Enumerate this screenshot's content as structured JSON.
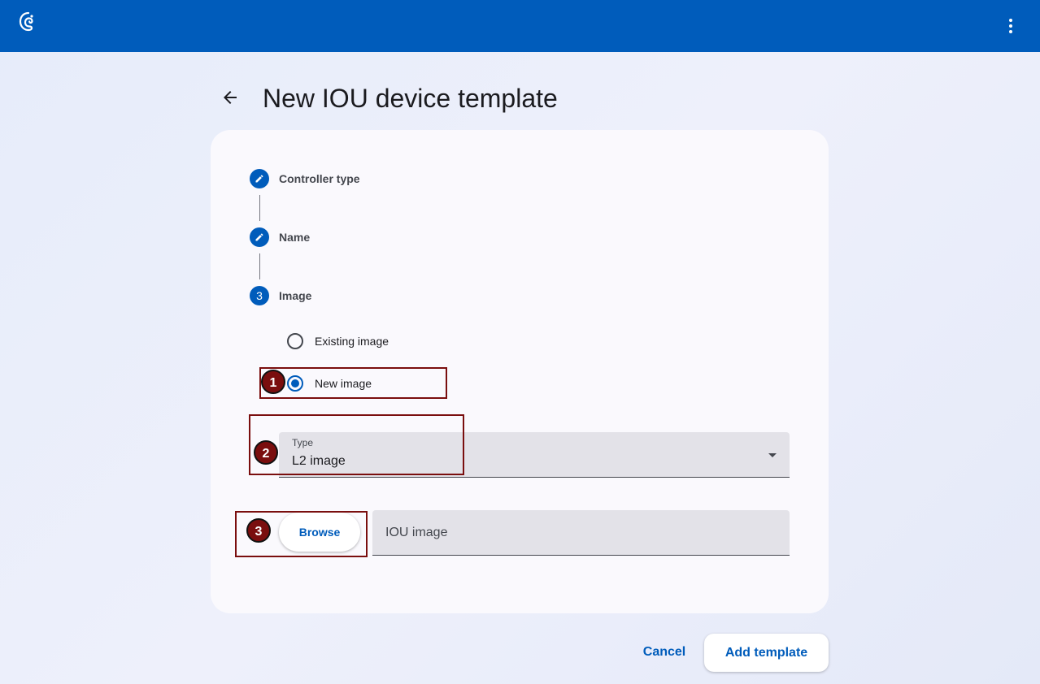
{
  "app": {
    "logo_icon": "chameleon-logo-icon",
    "menu_icon": "more-vert-icon",
    "brand_color": "#005cbb"
  },
  "page": {
    "title": "New IOU device template",
    "back_icon": "arrow-back-icon"
  },
  "stepper": {
    "steps": [
      {
        "marker": "edit-icon",
        "label": "Controller type"
      },
      {
        "marker": "edit-icon",
        "label": "Name"
      },
      {
        "number": "3",
        "label": "Image"
      }
    ]
  },
  "image_step": {
    "options": [
      {
        "label": "Existing image",
        "selected": false
      },
      {
        "label": "New image",
        "selected": true
      }
    ],
    "type_field": {
      "label": "Type",
      "value": "L2 image"
    },
    "browse_label": "Browse",
    "file_placeholder": "IOU image"
  },
  "annotations": [
    "1",
    "2",
    "3"
  ],
  "actions": {
    "cancel_label": "Cancel",
    "add_label": "Add template"
  }
}
